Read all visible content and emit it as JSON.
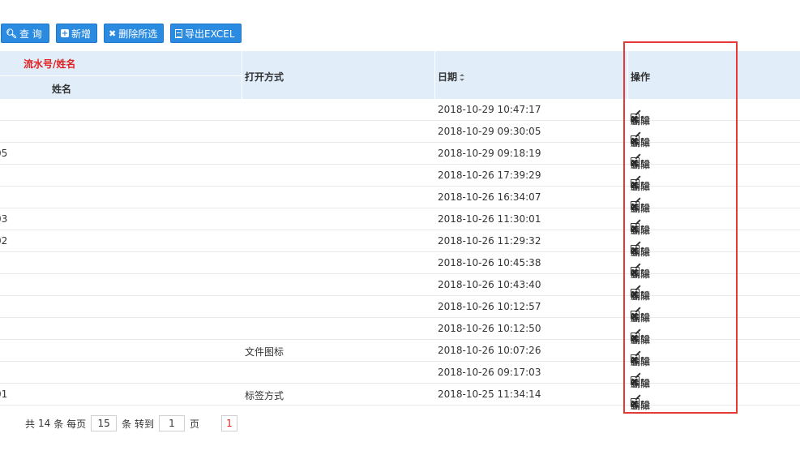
{
  "toolbar": {
    "query_label": "查 询",
    "add_label": "新增",
    "delete_selected_label": "删除所选",
    "export_label": "导出EXCEL"
  },
  "table": {
    "headers": {
      "serial_name": "流水号/姓名",
      "name": "姓名",
      "open_method": "打开方式",
      "date": "日期",
      "actions": "操作"
    },
    "actions": {
      "edit": "编辑",
      "delete": "删除"
    },
    "rows": [
      {
        "serial": "",
        "open": "",
        "date": "2018-10-29 10:47:17"
      },
      {
        "serial": "",
        "open": "",
        "date": "2018-10-29 09:30:05"
      },
      {
        "serial": "05",
        "open": "",
        "date": "2018-10-29 09:18:19"
      },
      {
        "serial": "",
        "open": "",
        "date": "2018-10-26 17:39:29"
      },
      {
        "serial": "",
        "open": "",
        "date": "2018-10-26 16:34:07"
      },
      {
        "serial": "03",
        "open": "",
        "date": "2018-10-26 11:30:01"
      },
      {
        "serial": "02",
        "open": "",
        "date": "2018-10-26 11:29:32"
      },
      {
        "serial": "",
        "open": "",
        "date": "2018-10-26 10:45:38"
      },
      {
        "serial": "",
        "open": "",
        "date": "2018-10-26 10:43:40"
      },
      {
        "serial": "",
        "open": "",
        "date": "2018-10-26 10:12:57"
      },
      {
        "serial": "",
        "open": "",
        "date": "2018-10-26 10:12:50"
      },
      {
        "serial": "",
        "open": "文件图标",
        "date": "2018-10-26 10:07:26"
      },
      {
        "serial": "",
        "open": "",
        "date": "2018-10-26 09:17:03"
      },
      {
        "serial": "01",
        "open": "标签方式",
        "date": "2018-10-25 11:34:14"
      }
    ]
  },
  "pager": {
    "total_prefix": "共",
    "total": "14",
    "total_suffix": "条 每页",
    "per_page": "15",
    "goto_prefix": "条 转到",
    "goto_page": "1",
    "goto_suffix": "页",
    "current_page": "1"
  },
  "colors": {
    "accent": "#2b8be0",
    "header_bg": "#e1eefa",
    "highlight": "#e53935",
    "red_text": "#e02020"
  }
}
